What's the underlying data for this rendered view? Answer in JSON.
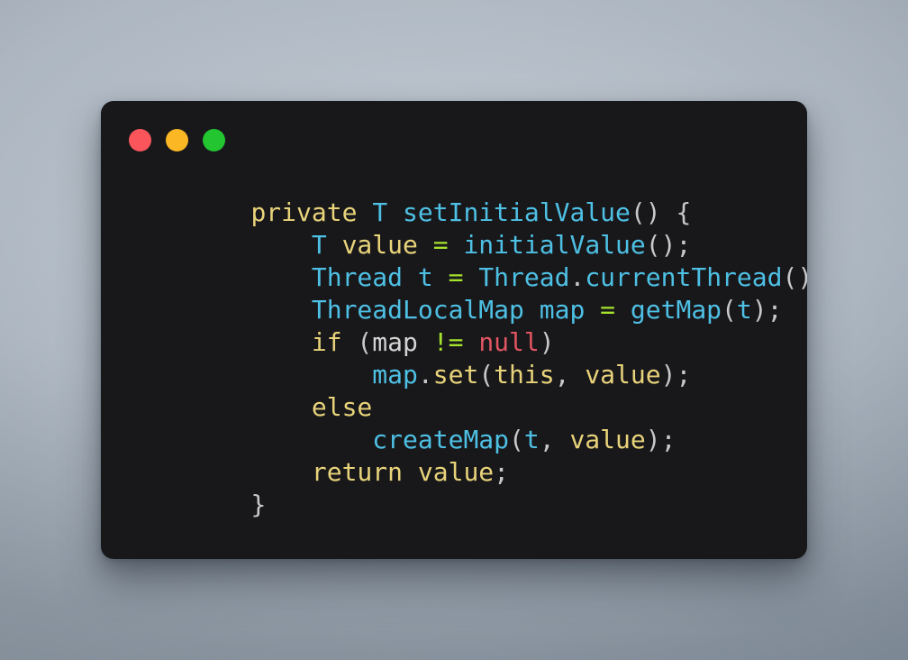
{
  "window": {
    "traffic_lights": [
      {
        "name": "close",
        "color": "#f9555a"
      },
      {
        "name": "minimize",
        "color": "#fbb724"
      },
      {
        "name": "zoom",
        "color": "#23c531"
      }
    ],
    "background_color": "#18181b",
    "canvas_color": "#aab3bd"
  },
  "theme": {
    "keyword": "#e8d37a",
    "type": "#4ec0e4",
    "function": "#4ec0e4",
    "variable": "#e8d37a",
    "operator": "#a6e22e",
    "null_literal": "#e05561",
    "punctuation": "#c8c8c8",
    "foreground": "#d4d4d4"
  },
  "code": {
    "language": "java",
    "plain_text": "    private T setInitialValue() {\n        T value = initialValue();\n        Thread t = Thread.currentThread();\n        ThreadLocalMap map = getMap(t);\n        if (map != null)\n            map.set(this, value);\n        else\n            createMap(t, value);\n        return value;\n    }",
    "lines": [
      {
        "index": 1,
        "text": "    private T setInitialValue() {",
        "tokens": [
          {
            "t": "    ",
            "c": "plain"
          },
          {
            "t": "private",
            "c": "kw"
          },
          {
            "t": " ",
            "c": "plain"
          },
          {
            "t": "T",
            "c": "type"
          },
          {
            "t": " ",
            "c": "plain"
          },
          {
            "t": "setInitialValue",
            "c": "fn"
          },
          {
            "t": "() {",
            "c": "punct"
          }
        ]
      },
      {
        "index": 2,
        "text": "        T value = initialValue();",
        "tokens": [
          {
            "t": "        ",
            "c": "plain"
          },
          {
            "t": "T",
            "c": "type"
          },
          {
            "t": " ",
            "c": "plain"
          },
          {
            "t": "value",
            "c": "var"
          },
          {
            "t": " ",
            "c": "plain"
          },
          {
            "t": "=",
            "c": "op"
          },
          {
            "t": " ",
            "c": "plain"
          },
          {
            "t": "initialValue",
            "c": "fn"
          },
          {
            "t": "();",
            "c": "punct"
          }
        ]
      },
      {
        "index": 3,
        "text": "        Thread t = Thread.currentThread();",
        "tokens": [
          {
            "t": "        ",
            "c": "plain"
          },
          {
            "t": "Thread",
            "c": "type"
          },
          {
            "t": " ",
            "c": "plain"
          },
          {
            "t": "t",
            "c": "type"
          },
          {
            "t": " ",
            "c": "plain"
          },
          {
            "t": "=",
            "c": "op"
          },
          {
            "t": " ",
            "c": "plain"
          },
          {
            "t": "Thread",
            "c": "type"
          },
          {
            "t": ".",
            "c": "punct"
          },
          {
            "t": "currentThread",
            "c": "fn"
          },
          {
            "t": "();",
            "c": "punct"
          }
        ]
      },
      {
        "index": 4,
        "text": "        ThreadLocalMap map = getMap(t);",
        "tokens": [
          {
            "t": "        ",
            "c": "plain"
          },
          {
            "t": "ThreadLocalMap",
            "c": "type"
          },
          {
            "t": " ",
            "c": "plain"
          },
          {
            "t": "map",
            "c": "type"
          },
          {
            "t": " ",
            "c": "plain"
          },
          {
            "t": "=",
            "c": "op"
          },
          {
            "t": " ",
            "c": "plain"
          },
          {
            "t": "getMap",
            "c": "fn"
          },
          {
            "t": "(",
            "c": "punct"
          },
          {
            "t": "t",
            "c": "type"
          },
          {
            "t": ");",
            "c": "punct"
          }
        ]
      },
      {
        "index": 5,
        "text": "        if (map != null)",
        "tokens": [
          {
            "t": "        ",
            "c": "plain"
          },
          {
            "t": "if",
            "c": "kw"
          },
          {
            "t": " (",
            "c": "punct"
          },
          {
            "t": "map",
            "c": "plain"
          },
          {
            "t": " ",
            "c": "plain"
          },
          {
            "t": "!=",
            "c": "op"
          },
          {
            "t": " ",
            "c": "plain"
          },
          {
            "t": "null",
            "c": "null"
          },
          {
            "t": ")",
            "c": "punct"
          }
        ]
      },
      {
        "index": 6,
        "text": "            map.set(this, value);",
        "tokens": [
          {
            "t": "            ",
            "c": "plain"
          },
          {
            "t": "map",
            "c": "type"
          },
          {
            "t": ".",
            "c": "punct"
          },
          {
            "t": "set",
            "c": "var"
          },
          {
            "t": "(",
            "c": "punct"
          },
          {
            "t": "this",
            "c": "var"
          },
          {
            "t": ", ",
            "c": "punct"
          },
          {
            "t": "value",
            "c": "var"
          },
          {
            "t": ");",
            "c": "punct"
          }
        ]
      },
      {
        "index": 7,
        "text": "        else",
        "tokens": [
          {
            "t": "        ",
            "c": "plain"
          },
          {
            "t": "else",
            "c": "kw"
          }
        ]
      },
      {
        "index": 8,
        "text": "            createMap(t, value);",
        "tokens": [
          {
            "t": "            ",
            "c": "plain"
          },
          {
            "t": "createMap",
            "c": "fn"
          },
          {
            "t": "(",
            "c": "punct"
          },
          {
            "t": "t",
            "c": "type"
          },
          {
            "t": ", ",
            "c": "punct"
          },
          {
            "t": "value",
            "c": "var"
          },
          {
            "t": ");",
            "c": "punct"
          }
        ]
      },
      {
        "index": 9,
        "text": "        return value;",
        "tokens": [
          {
            "t": "        ",
            "c": "plain"
          },
          {
            "t": "return",
            "c": "kw"
          },
          {
            "t": " ",
            "c": "plain"
          },
          {
            "t": "value",
            "c": "var"
          },
          {
            "t": ";",
            "c": "punct"
          }
        ]
      },
      {
        "index": 10,
        "text": "    }",
        "tokens": [
          {
            "t": "    ",
            "c": "plain"
          },
          {
            "t": "}",
            "c": "punct"
          }
        ]
      }
    ]
  }
}
